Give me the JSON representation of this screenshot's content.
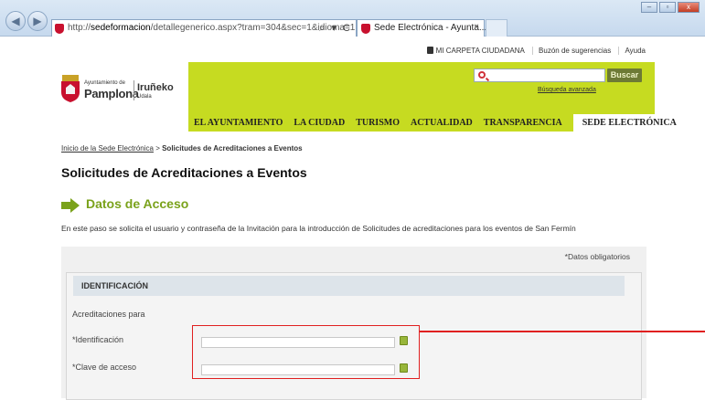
{
  "browser": {
    "url_prefix": "http://",
    "url_domain": "sedeformacion",
    "url_path": "/detallegenerico.aspx?tram=304&sec=1&idioma=1",
    "url_controls": "⌕ ▾ C",
    "tab_title": "Sede Electrónica - Ayunta...",
    "tab_close": "×",
    "window_controls": [
      "–",
      "▫",
      "x"
    ]
  },
  "util_links": [
    "MI CARPETA CIUDADANA",
    "Buzón de sugerencias",
    "Ayuda"
  ],
  "logo": {
    "line1": "Ayuntamiento de",
    "line2": "Pamplona",
    "line3": "Iruñeko",
    "line4": "Udala"
  },
  "search": {
    "button_label": "Buscar",
    "advanced_link": "Búsqueda avanzada"
  },
  "main_nav": [
    {
      "label": "EL AYUNTAMIENTO"
    },
    {
      "label": "LA CIUDAD"
    },
    {
      "label": "TURISMO"
    },
    {
      "label": "ACTUALIDAD"
    },
    {
      "label": "TRANSPARENCIA"
    },
    {
      "label": "SEDE ELECTRÓNICA",
      "active": true
    }
  ],
  "breadcrumb": {
    "home": "Inicio de la Sede Electrónica",
    "separator": ">",
    "current": "Solicitudes de Acreditaciones a Eventos"
  },
  "page_title": "Solicitudes de Acreditaciones a Eventos",
  "step_title": "Datos de Acceso",
  "intro_text": "En este paso se solicita el usuario y contraseña de la Invitación para la introducción de Solicitudes de acreditaciones para los eventos de San Fermín",
  "form": {
    "required_note": "*Datos obligatorios",
    "section_header": "IDENTIFICACIÓN",
    "subheading": "Acreditaciones para",
    "fields": [
      {
        "label": "*Identificación",
        "value": ""
      },
      {
        "label": "*Clave de acceso",
        "value": ""
      }
    ]
  },
  "colors": {
    "brand_green": "#c6db21",
    "step_green": "#7aa21b",
    "highlight_red": "#e02020"
  }
}
